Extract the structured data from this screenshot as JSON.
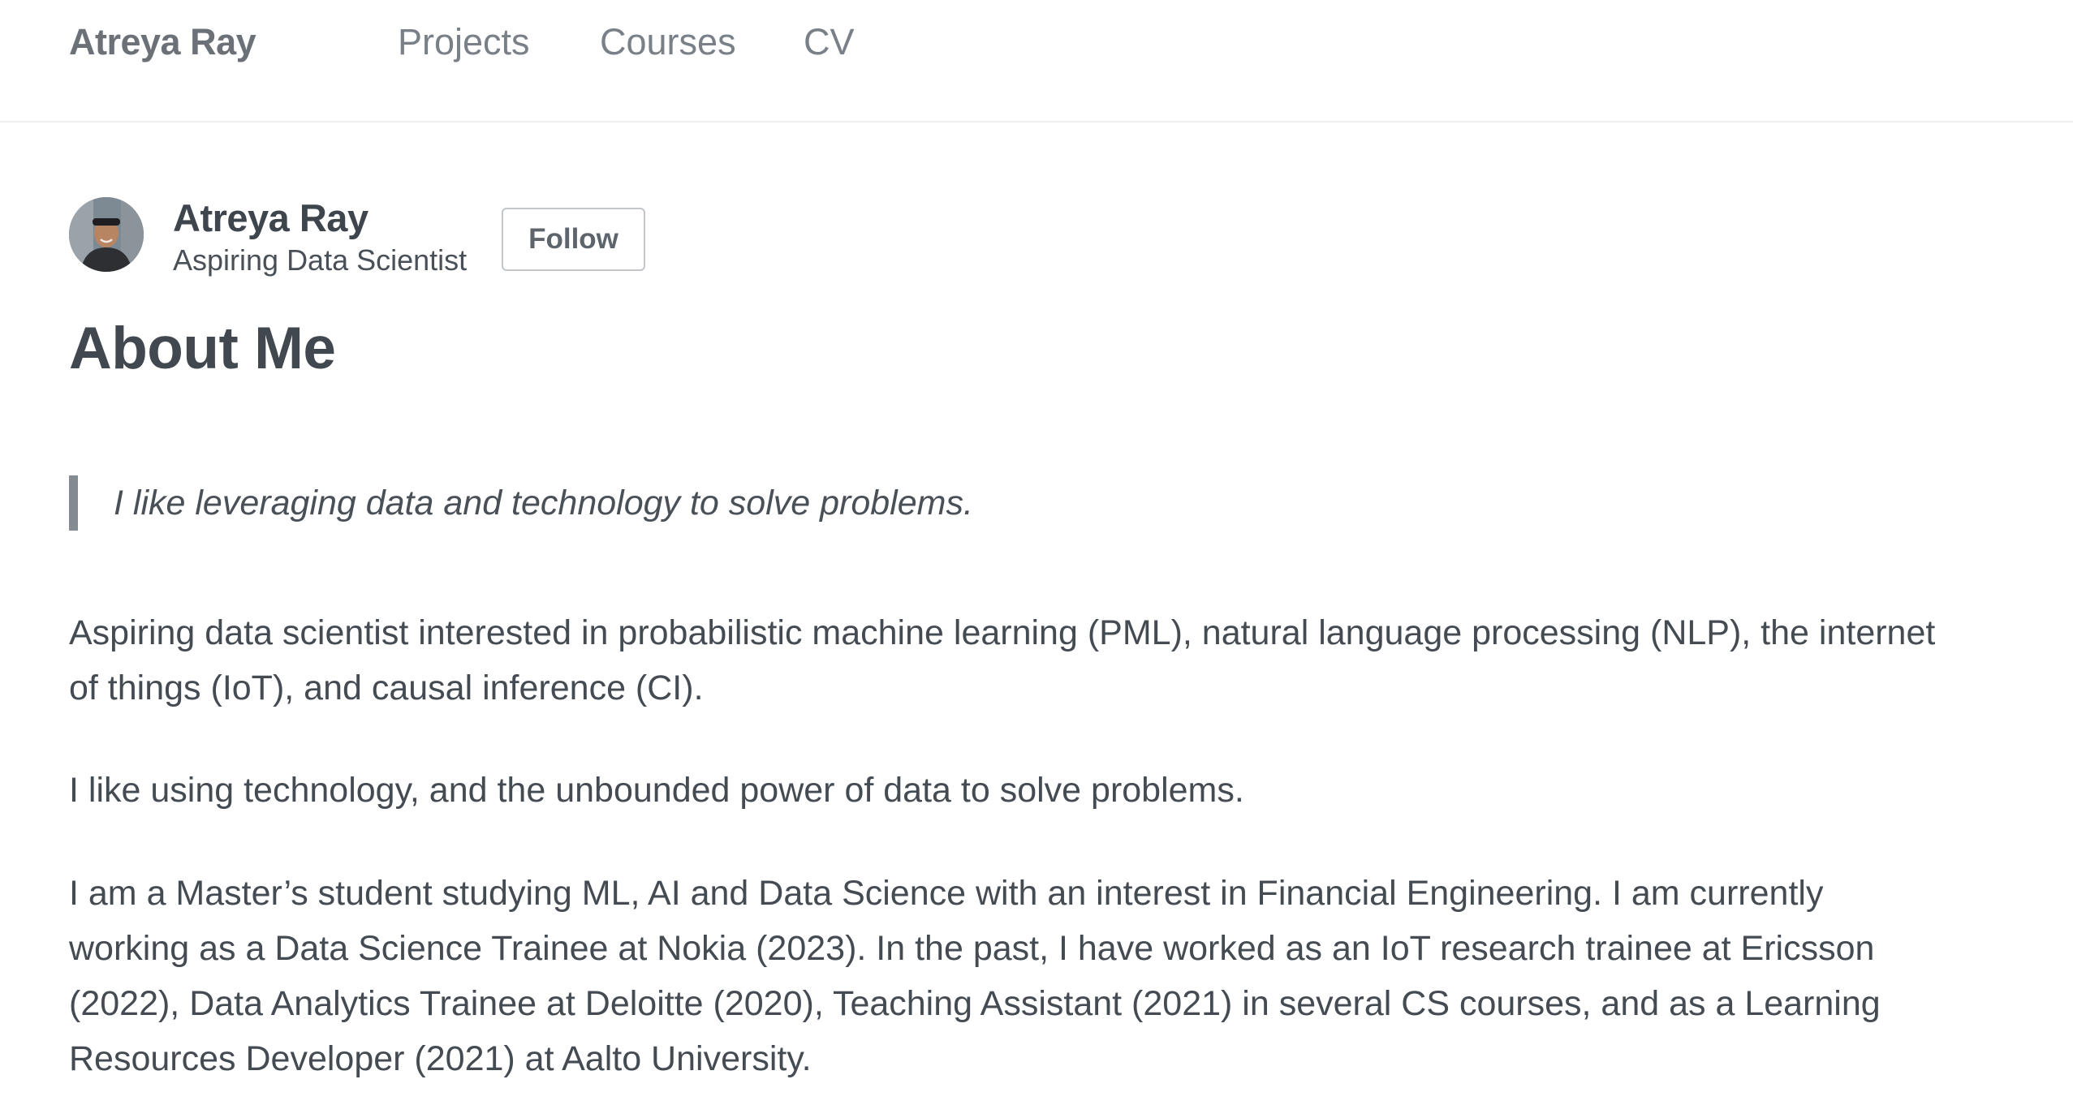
{
  "nav": {
    "brand": "Atreya Ray",
    "links": [
      {
        "label": "Projects"
      },
      {
        "label": "Courses"
      },
      {
        "label": "CV"
      }
    ]
  },
  "profile": {
    "name": "Atreya Ray",
    "title": "Aspiring Data Scientist",
    "follow_label": "Follow"
  },
  "page": {
    "title": "About Me",
    "quote": "I like leveraging data and technology to solve problems.",
    "paragraphs": [
      "Aspiring data scientist interested in probabilistic machine learning (PML), natural language processing (NLP), the internet of things (IoT), and causal inference (CI).",
      "I like using technology, and the unbounded power of data to solve problems.",
      "I am a Master’s student studying ML, AI and Data Science with an interest in Financial Engineering. I am currently working as a Data Science Trainee at Nokia (2023). In the past, I have worked as an IoT research trainee at Ericsson (2022), Data Analytics Trainee at Deloitte (2020), Teaching Assistant (2021) in several CS courses, and as a Learning Resources Developer (2021) at Aalto University."
    ]
  },
  "colors": {
    "text": "#454b52",
    "nav_text": "#7a8087",
    "quote_bar": "#838a91",
    "divider": "#eef0f2"
  }
}
